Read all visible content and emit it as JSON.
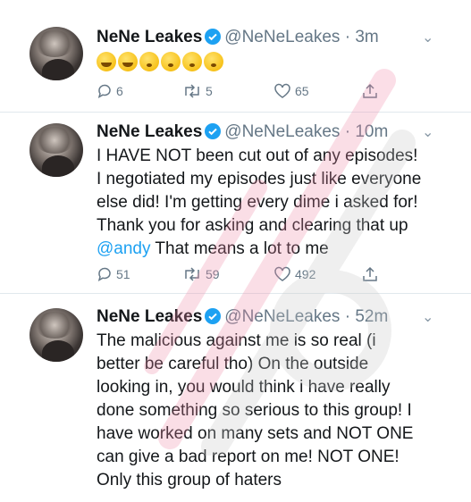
{
  "tweets": [
    {
      "name": "NeNe Leakes",
      "handle": "@NeNeLeakes",
      "time": "3m",
      "emojis": [
        "joy-face",
        "rofl-face",
        "hushed-face",
        "hushed-face",
        "hushed-face",
        "hushed-face"
      ],
      "replies": "6",
      "retweets": "5",
      "likes": "65"
    },
    {
      "name": "NeNe Leakes",
      "handle": "@NeNeLeakes",
      "time": "10m",
      "lines": [
        "I HAVE NOT been cut out of any episodes!",
        "I negotiated my episodes just like everyone",
        "else did! I'm getting every dime i asked for!",
        "Thank you for asking and clearing that up"
      ],
      "mention": "@andy",
      "last_line": " That means a lot to me",
      "replies": "51",
      "retweets": "59",
      "likes": "492"
    },
    {
      "name": "NeNe Leakes",
      "handle": "@NeNeLeakes",
      "time": "52m",
      "lines": [
        "The malicious against me is so real (i",
        "better be careful tho) On the outside",
        "looking in, you would think i have really",
        "done something so serious to this group! I",
        "have worked on many sets and NOT ONE",
        "can give a bad report on me! NOT ONE!",
        "Only this group of haters"
      ]
    }
  ],
  "colors": {
    "accent": "#1da1f2",
    "muted": "#657786",
    "text": "#14171a",
    "watermark": "#f08aa8"
  }
}
